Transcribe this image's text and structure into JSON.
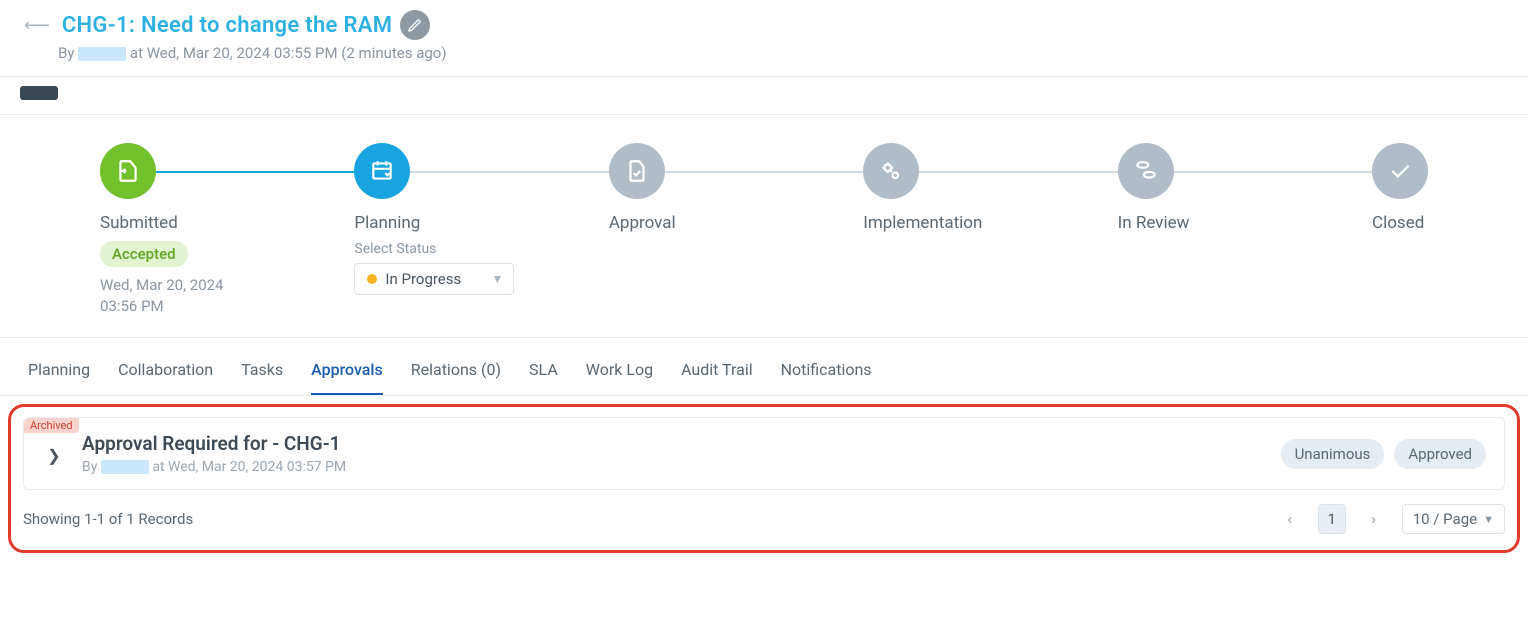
{
  "header": {
    "title": "CHG-1: Need to change the RAM",
    "by_prefix": "By",
    "by_rest": "at Wed, Mar 20, 2024 03:55 PM (2 minutes ago)"
  },
  "workflow": {
    "steps": [
      {
        "label": "Submitted",
        "state": "done",
        "badge": "Accepted",
        "date_line1": "Wed, Mar 20, 2024",
        "date_line2": "03:56 PM"
      },
      {
        "label": "Planning",
        "state": "current",
        "select_label": "Select Status",
        "status_value": "In Progress"
      },
      {
        "label": "Approval",
        "state": "future"
      },
      {
        "label": "Implementation",
        "state": "future"
      },
      {
        "label": "In Review",
        "state": "future"
      },
      {
        "label": "Closed",
        "state": "future"
      }
    ]
  },
  "tabs": [
    {
      "label": "Planning"
    },
    {
      "label": "Collaboration"
    },
    {
      "label": "Tasks"
    },
    {
      "label": "Approvals",
      "active": true
    },
    {
      "label": "Relations (0)"
    },
    {
      "label": "SLA"
    },
    {
      "label": "Work Log"
    },
    {
      "label": "Audit Trail"
    },
    {
      "label": "Notifications"
    }
  ],
  "approvals": {
    "card": {
      "archived_tag": "Archived",
      "title": "Approval Required for - CHG-1",
      "meta_prefix": "By",
      "meta_rest": "at Wed, Mar 20, 2024 03:57 PM",
      "badges": [
        "Unanimous",
        "Approved"
      ]
    },
    "pagination": {
      "summary": "Showing 1-1 of 1 Records",
      "current_page": "1",
      "page_size": "10 / Page"
    }
  }
}
